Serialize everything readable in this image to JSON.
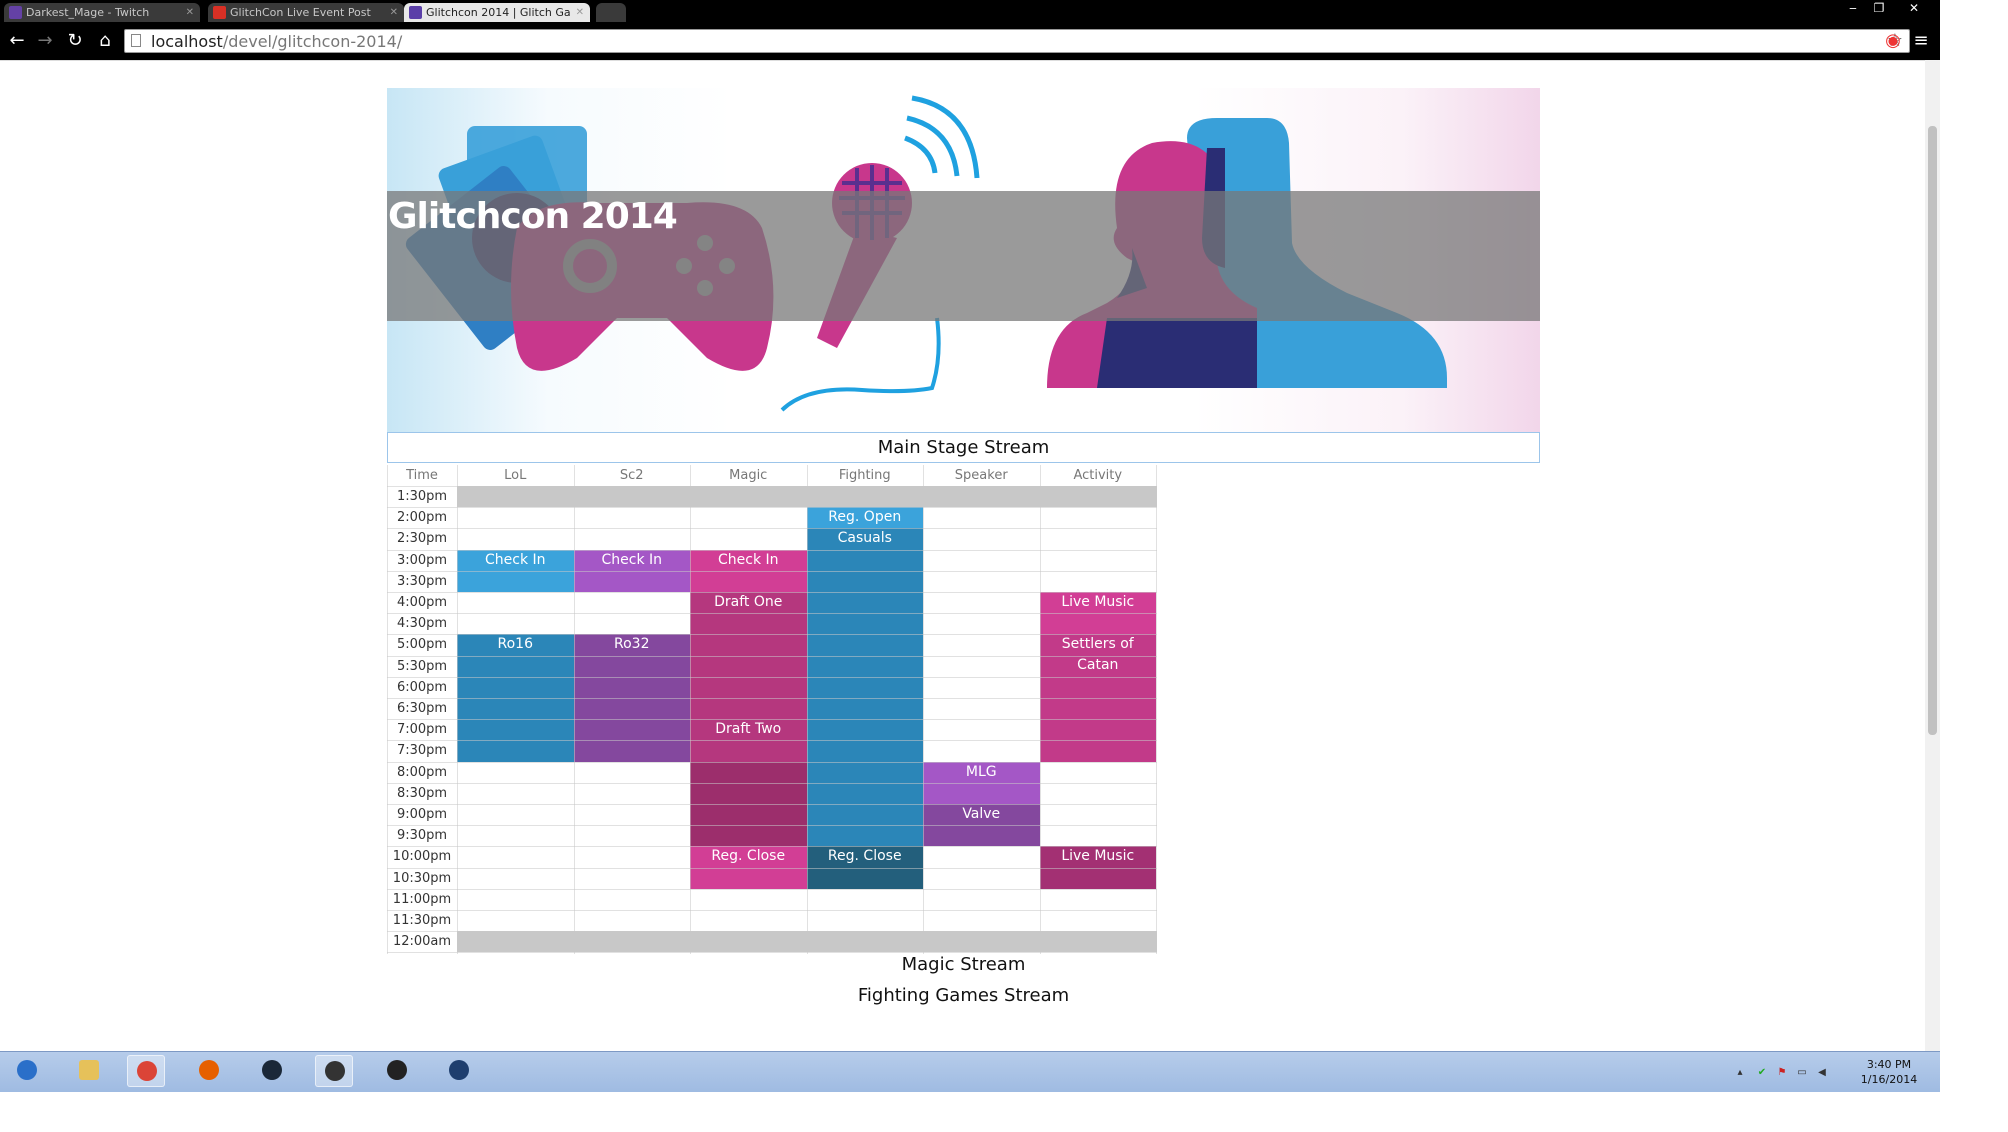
{
  "browser": {
    "tabs": [
      {
        "title": "Darkest_Mage - Twitch",
        "favicon_color": "#6441a5",
        "active": false
      },
      {
        "title": "GlitchCon Live Event Post",
        "favicon_color": "#d93025",
        "active": false
      },
      {
        "title": "Glitchcon 2014 | Glitch Ga",
        "favicon_color": "#5b3fa8",
        "active": true
      }
    ],
    "url_host": "localhost",
    "url_path": "/devel/glitchcon-2014/",
    "window_controls": [
      "‒",
      "❐",
      "✕"
    ]
  },
  "page": {
    "title": "Glitchcon 2014",
    "main_stream_label": "Main Stage Stream",
    "stream_links": [
      "Magic Stream",
      "Fighting Games Stream"
    ]
  },
  "schedule": {
    "time_header": "Time",
    "columns": [
      "LoL",
      "Sc2",
      "Magic",
      "Fighting",
      "Speaker",
      "Activity"
    ],
    "times": [
      "1:30pm",
      "2:00pm",
      "2:30pm",
      "3:00pm",
      "3:30pm",
      "4:00pm",
      "4:30pm",
      "5:00pm",
      "5:30pm",
      "6:00pm",
      "6:30pm",
      "7:00pm",
      "7:30pm",
      "8:00pm",
      "8:30pm",
      "9:00pm",
      "9:30pm",
      "10:00pm",
      "10:30pm",
      "11:00pm",
      "11:30pm",
      "12:00am"
    ],
    "blocked_slots": [
      "1:30pm",
      "12:00am"
    ],
    "events": [
      {
        "column": "Fighting",
        "start": "2:00pm",
        "end": "2:30pm",
        "lines": [
          "Reg. Open"
        ],
        "color": "#3ba3db"
      },
      {
        "column": "Fighting",
        "start": "2:30pm",
        "end": "10:00pm",
        "lines": [
          "Casuals"
        ],
        "color": "#2b86b8"
      },
      {
        "column": "Fighting",
        "start": "10:00pm",
        "end": "11:00pm",
        "lines": [
          "Reg. Close"
        ],
        "color": "#235f7c"
      },
      {
        "column": "LoL",
        "start": "3:00pm",
        "end": "4:00pm",
        "lines": [
          "Check In"
        ],
        "color": "#3ba3db"
      },
      {
        "column": "LoL",
        "start": "5:00pm",
        "end": "8:00pm",
        "lines": [
          "Ro16"
        ],
        "color": "#2b86b8"
      },
      {
        "column": "Sc2",
        "start": "3:00pm",
        "end": "4:00pm",
        "lines": [
          "Check In"
        ],
        "color": "#a457c6"
      },
      {
        "column": "Sc2",
        "start": "5:00pm",
        "end": "8:00pm",
        "lines": [
          "Ro32"
        ],
        "color": "#84489e"
      },
      {
        "column": "Magic",
        "start": "3:00pm",
        "end": "4:00pm",
        "lines": [
          "Check In"
        ],
        "color": "#d23e95"
      },
      {
        "column": "Magic",
        "start": "4:00pm",
        "end": "7:00pm",
        "lines": [
          "Draft One"
        ],
        "color": "#b5377e"
      },
      {
        "column": "Magic",
        "start": "7:00pm",
        "end": "8:00pm",
        "lines": [
          "Draft Two"
        ],
        "color": "#b5377e"
      },
      {
        "column": "Magic",
        "start": "8:00pm",
        "end": "10:00pm",
        "lines": [],
        "color": "#9c2e6c"
      },
      {
        "column": "Magic",
        "start": "10:00pm",
        "end": "11:00pm",
        "lines": [
          "Reg. Close"
        ],
        "color": "#d23e95"
      },
      {
        "column": "Speaker",
        "start": "8:00pm",
        "end": "9:00pm",
        "lines": [
          "MLG"
        ],
        "color": "#a457c6"
      },
      {
        "column": "Speaker",
        "start": "9:00pm",
        "end": "10:00pm",
        "lines": [
          "Valve"
        ],
        "color": "#84489e"
      },
      {
        "column": "Activity",
        "start": "4:00pm",
        "end": "5:00pm",
        "lines": [
          "Live Music"
        ],
        "color": "#d23e95"
      },
      {
        "column": "Activity",
        "start": "5:00pm",
        "end": "8:00pm",
        "lines": [
          "Settlers of",
          "Catan"
        ],
        "color": "#c23a89"
      },
      {
        "column": "Activity",
        "start": "10:00pm",
        "end": "11:00pm",
        "lines": [
          "Live Music"
        ],
        "color": "#a33073"
      }
    ]
  },
  "taskbar": {
    "apps": [
      {
        "name": "start-button-icon",
        "color": "#2a6fc9",
        "active": false
      },
      {
        "name": "file-explorer-icon",
        "color": "#e6c15a",
        "active": false
      },
      {
        "name": "chrome-icon",
        "color": "#db4437",
        "active": true
      },
      {
        "name": "firefox-icon",
        "color": "#e66000",
        "active": false
      },
      {
        "name": "steam-icon",
        "color": "#1b2838",
        "active": false
      },
      {
        "name": "app-icon",
        "color": "#333333",
        "active": true
      },
      {
        "name": "app-icon",
        "color": "#222222",
        "active": false
      },
      {
        "name": "app-icon",
        "color": "#1e3e6e",
        "active": false
      }
    ],
    "clock_time": "3:40 PM",
    "clock_date": "1/16/2014"
  }
}
